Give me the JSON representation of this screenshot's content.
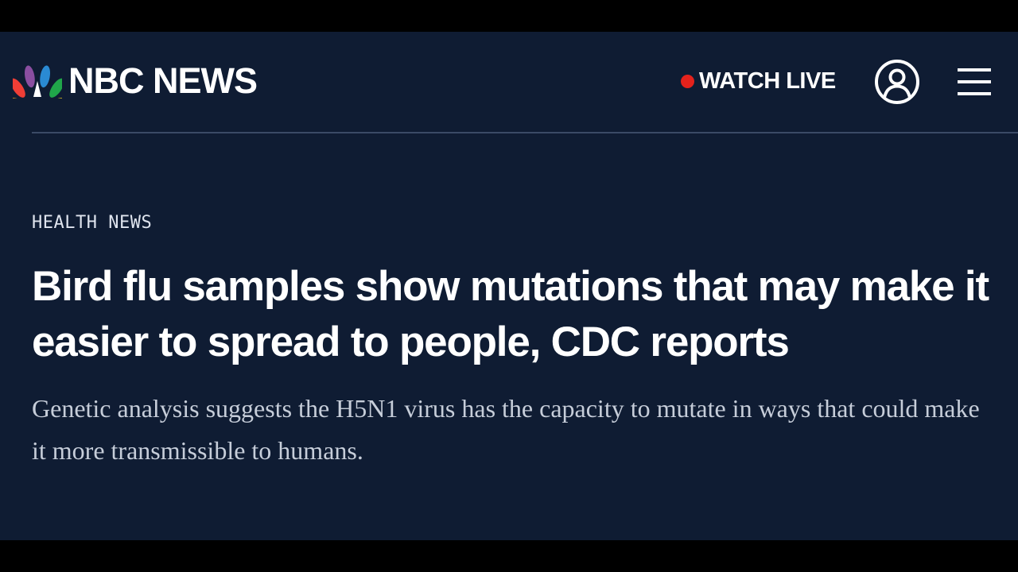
{
  "header": {
    "logo_text": "NBC NEWS",
    "logo_icon": "nbc-peacock-icon",
    "watch_live_label": "WATCH LIVE",
    "account_icon": "user-account-icon",
    "menu_icon": "hamburger-menu-icon"
  },
  "article": {
    "category": "HEALTH NEWS",
    "headline": "Bird flu samples show mutations that may make it easier to spread to people, CDC reports",
    "dek": "Genetic analysis suggests the H5N1 virus has the capacity to mutate in ways that could make it more transmissible to humans."
  },
  "colors": {
    "background": "#0f1c33",
    "letterbox": "#000000",
    "live_dot": "#e4221c",
    "text_primary": "#ffffff",
    "text_secondary": "#c6cdd9",
    "divider": "#3b4a66"
  }
}
